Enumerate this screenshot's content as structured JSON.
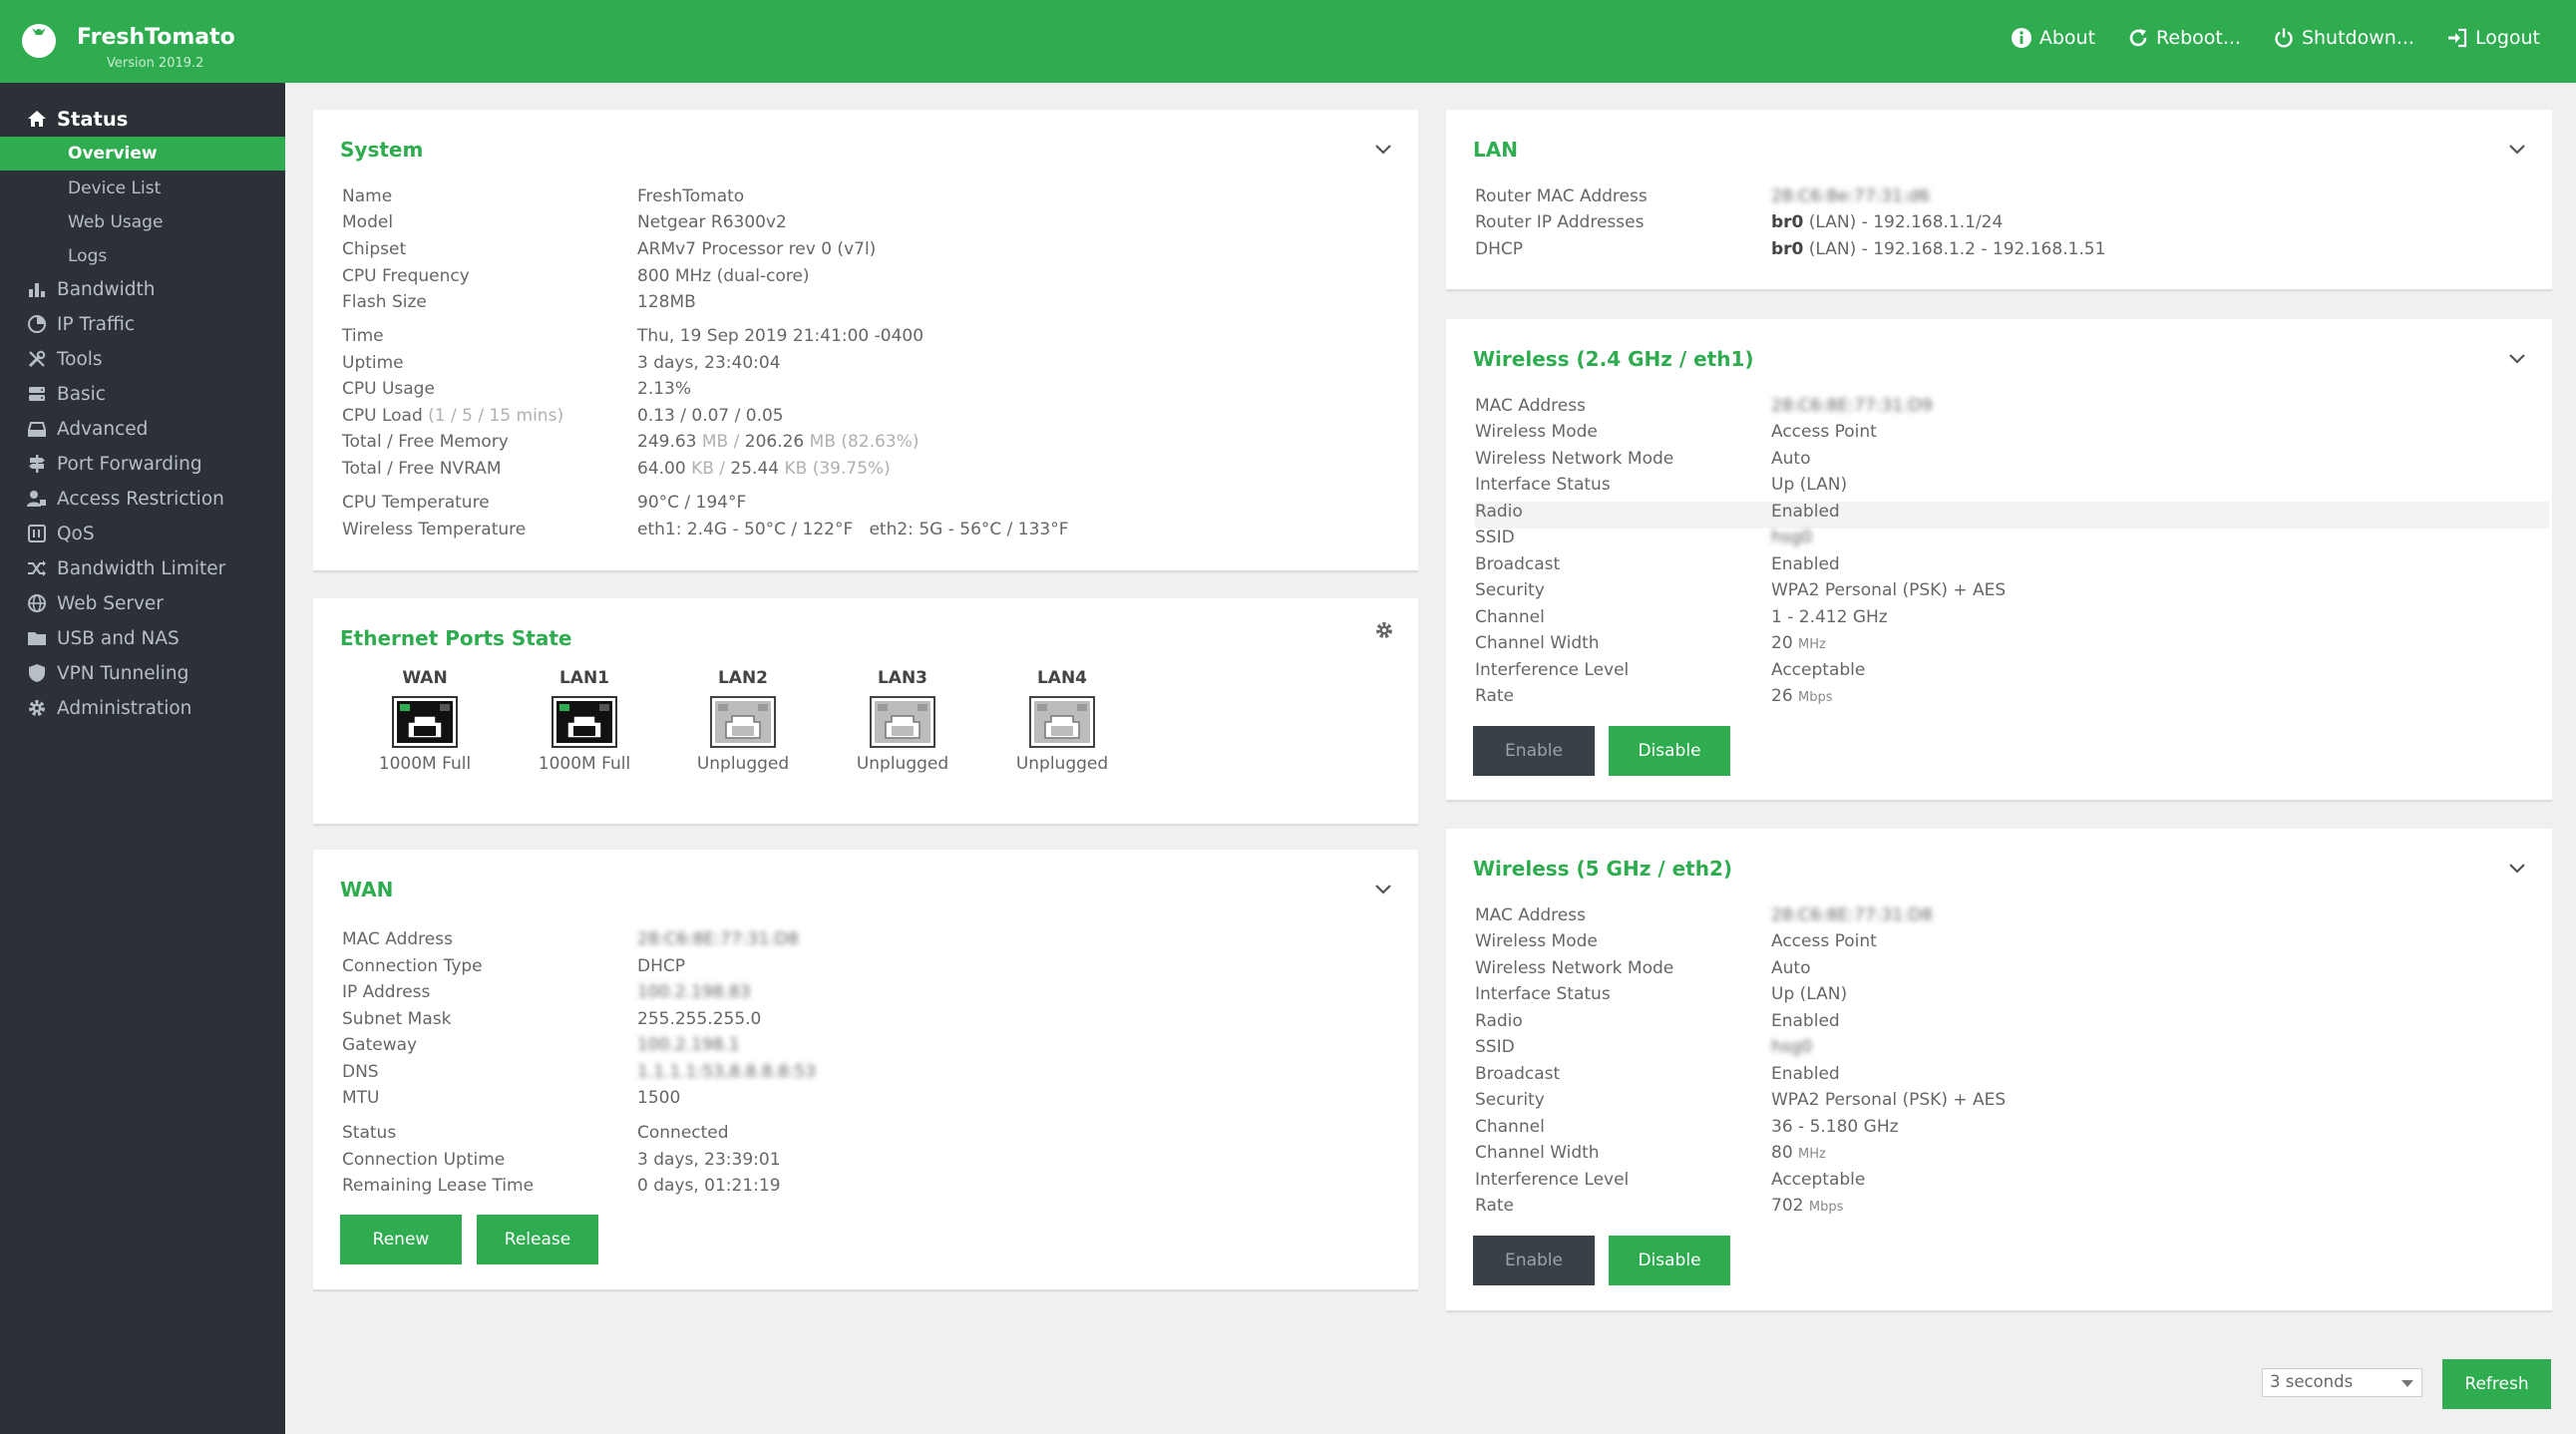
{
  "header": {
    "brand": "FreshTomato",
    "version": "Version 2019.2",
    "nav": [
      {
        "label": "About",
        "icon": "info-icon"
      },
      {
        "label": "Reboot...",
        "icon": "reboot-icon"
      },
      {
        "label": "Shutdown...",
        "icon": "power-icon"
      },
      {
        "label": "Logout",
        "icon": "logout-icon"
      }
    ]
  },
  "sidebar": {
    "status": {
      "label": "Status",
      "icon": "home-icon"
    },
    "subitems": [
      "Overview",
      "Device List",
      "Web Usage",
      "Logs"
    ],
    "items": [
      {
        "label": "Bandwidth",
        "icon": "bar-chart-icon"
      },
      {
        "label": "IP Traffic",
        "icon": "pie-chart-icon"
      },
      {
        "label": "Tools",
        "icon": "tools-icon"
      },
      {
        "label": "Basic",
        "icon": "server-icon"
      },
      {
        "label": "Advanced",
        "icon": "hdd-icon"
      },
      {
        "label": "Port Forwarding",
        "icon": "signpost-icon"
      },
      {
        "label": "Access Restriction",
        "icon": "user-lock-icon"
      },
      {
        "label": "QoS",
        "icon": "qos-icon"
      },
      {
        "label": "Bandwidth Limiter",
        "icon": "random-icon"
      },
      {
        "label": "Web Server",
        "icon": "globe-icon"
      },
      {
        "label": "USB and NAS",
        "icon": "folder-icon"
      },
      {
        "label": "VPN Tunneling",
        "icon": "shield-icon"
      },
      {
        "label": "Administration",
        "icon": "cog-icon"
      }
    ]
  },
  "system": {
    "title": "System",
    "rows": [
      {
        "k": "Name",
        "v": "FreshTomato"
      },
      {
        "k": "Model",
        "v": "Netgear R6300v2"
      },
      {
        "k": "Chipset",
        "v": "ARMv7 Processor rev 0 (v7l)"
      },
      {
        "k": "CPU Frequency",
        "v": "800 MHz (dual-core)"
      },
      {
        "k": "Flash Size",
        "v": "128MB"
      },
      {
        "k": "Time",
        "v": "Thu, 19 Sep 2019 21:41:00 -0400"
      },
      {
        "k": "Uptime",
        "v": "3 days, 23:40:04"
      },
      {
        "k": "CPU Usage",
        "v": "2.13%"
      },
      {
        "k": "CPU Load",
        "k_muted": "(1 / 5 / 15 mins)",
        "v": "0.13 / 0.07 / 0.05"
      },
      {
        "k": "Total / Free Memory",
        "v1": "249.63",
        "u1": " MB / ",
        "v2": "206.26",
        "u2": " MB (82.63%)"
      },
      {
        "k": "Total / Free NVRAM",
        "v1": "64.00",
        "u1": " KB / ",
        "v2": "25.44",
        "u2": " KB (39.75%)"
      },
      {
        "k": "CPU Temperature",
        "v": "90°C / 194°F"
      },
      {
        "k": "Wireless Temperature",
        "v": "eth1: 2.4G - 50°C / 122°F   eth2: 5G - 56°C / 133°F"
      }
    ]
  },
  "ethernet": {
    "title": "Ethernet Ports State",
    "ports": [
      {
        "name": "WAN",
        "state": "1000M Full",
        "connected": true
      },
      {
        "name": "LAN1",
        "state": "1000M Full",
        "connected": true
      },
      {
        "name": "LAN2",
        "state": "Unplugged",
        "connected": false
      },
      {
        "name": "LAN3",
        "state": "Unplugged",
        "connected": false
      },
      {
        "name": "LAN4",
        "state": "Unplugged",
        "connected": false
      }
    ]
  },
  "wan": {
    "title": "WAN",
    "rows": [
      {
        "k": "MAC Address",
        "v": "28:C6:8E:77:31:D8"
      },
      {
        "k": "Connection Type",
        "v": "DHCP"
      },
      {
        "k": "IP Address",
        "v": "100.2.198.83"
      },
      {
        "k": "Subnet Mask",
        "v": "255.255.255.0"
      },
      {
        "k": "Gateway",
        "v": "100.2.198.1"
      },
      {
        "k": "DNS",
        "v": "1.1.1.1:53,8.8.8.8:53"
      },
      {
        "k": "MTU",
        "v": "1500"
      },
      {
        "k": "Status",
        "v": "Connected"
      },
      {
        "k": "Connection Uptime",
        "v": "3 days, 23:39:01"
      },
      {
        "k": "Remaining Lease Time",
        "v": "0 days, 01:21:19"
      }
    ],
    "renew": "Renew",
    "release": "Release"
  },
  "lan": {
    "title": "LAN",
    "rows": [
      {
        "k": "Router MAC Address",
        "v": "28:C6:8e:77:31:d6"
      },
      {
        "k": "Router IP Addresses",
        "b": "br0",
        "v": " (LAN) - 192.168.1.1/24"
      },
      {
        "k": "DHCP",
        "b": "br0",
        "v": " (LAN) - 192.168.1.2 - 192.168.1.51"
      }
    ]
  },
  "wl24": {
    "title": "Wireless (2.4 GHz / eth1)",
    "rows": [
      {
        "k": "MAC Address",
        "v": "28:C6:8E:77:31:D9"
      },
      {
        "k": "Wireless Mode",
        "v": "Access Point"
      },
      {
        "k": "Wireless Network Mode",
        "v": "Auto"
      },
      {
        "k": "Interface Status",
        "v": "Up (LAN)"
      },
      {
        "k": "Radio",
        "v": "Enabled"
      },
      {
        "k": "SSID",
        "v": "hsg0"
      },
      {
        "k": "Broadcast",
        "v": "Enabled"
      },
      {
        "k": "Security",
        "v": "WPA2 Personal (PSK) + AES"
      },
      {
        "k": "Channel",
        "v": "1 - 2.412 GHz"
      },
      {
        "k": "Channel Width",
        "v": "20",
        "u": "MHz"
      },
      {
        "k": "Interference Level",
        "v": "Acceptable"
      },
      {
        "k": "Rate",
        "v": "26",
        "u": "Mbps"
      }
    ],
    "enable": "Enable",
    "disable": "Disable"
  },
  "wl5": {
    "title": "Wireless (5 GHz / eth2)",
    "rows": [
      {
        "k": "MAC Address",
        "v": "28:C6:8E:77:31:D8"
      },
      {
        "k": "Wireless Mode",
        "v": "Access Point"
      },
      {
        "k": "Wireless Network Mode",
        "v": "Auto"
      },
      {
        "k": "Interface Status",
        "v": "Up (LAN)"
      },
      {
        "k": "Radio",
        "v": "Enabled"
      },
      {
        "k": "SSID",
        "v": "hsg0"
      },
      {
        "k": "Broadcast",
        "v": "Enabled"
      },
      {
        "k": "Security",
        "v": "WPA2 Personal (PSK) + AES"
      },
      {
        "k": "Channel",
        "v": "36 - 5.180 GHz"
      },
      {
        "k": "Channel Width",
        "v": "80",
        "u": "MHz"
      },
      {
        "k": "Interference Level",
        "v": "Acceptable"
      },
      {
        "k": "Rate",
        "v": "702",
        "u": "Mbps"
      }
    ],
    "enable": "Enable",
    "disable": "Disable"
  },
  "footer": {
    "refresh_interval": "3 seconds",
    "refresh": "Refresh"
  },
  "colors": {
    "accent": "#2fac50",
    "sidebar": "#2b3136",
    "background": "#f0f0f0"
  }
}
